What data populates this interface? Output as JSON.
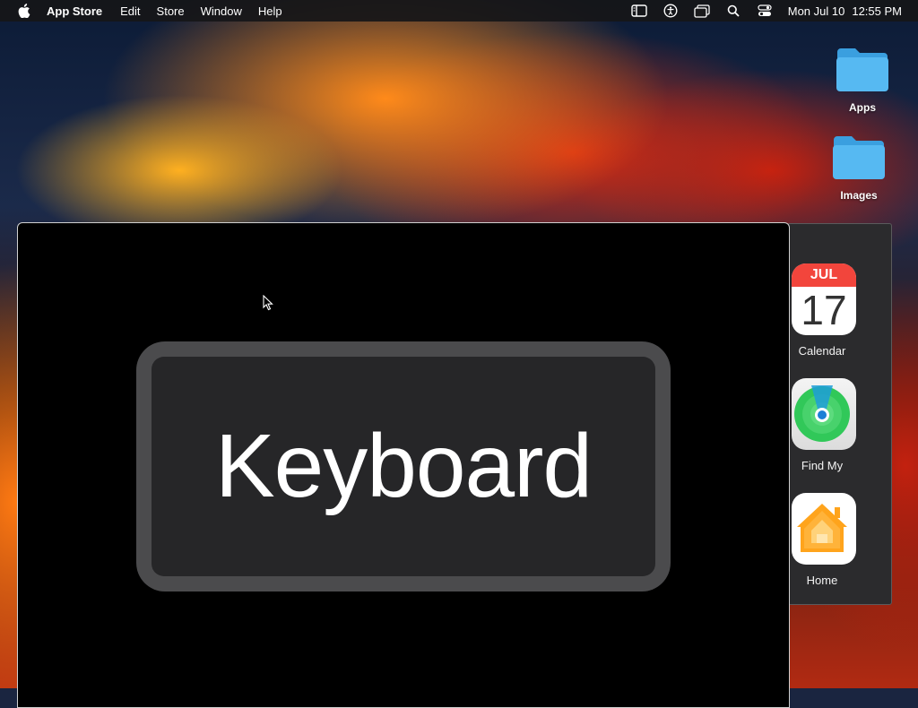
{
  "menubar": {
    "app_name": "App Store",
    "menus": [
      "Edit",
      "Store",
      "Window",
      "Help"
    ],
    "status_icons": [
      "sidebar-icon",
      "accessibility-icon",
      "window-icon",
      "search-icon",
      "control-center-icon"
    ],
    "date": "Mon Jul 10",
    "time": "12:55 PM"
  },
  "desktop": {
    "folders": [
      {
        "label": "Apps",
        "icon": "folder-icon"
      },
      {
        "label": "Images",
        "icon": "folder-icon"
      }
    ]
  },
  "dock": {
    "apps": [
      {
        "label": "Calendar",
        "icon": "calendar-icon",
        "month": "JUL",
        "day": "17"
      },
      {
        "label": "Find My",
        "icon": "find-my-icon"
      },
      {
        "label": "Home",
        "icon": "home-icon"
      }
    ]
  },
  "window": {
    "key_label": "Keyboard"
  },
  "colors": {
    "folder": "#4fb3f0",
    "calendar_red": "#f2453c",
    "findmy_green": "#34c759",
    "home_orange": "#ff9f0a"
  }
}
